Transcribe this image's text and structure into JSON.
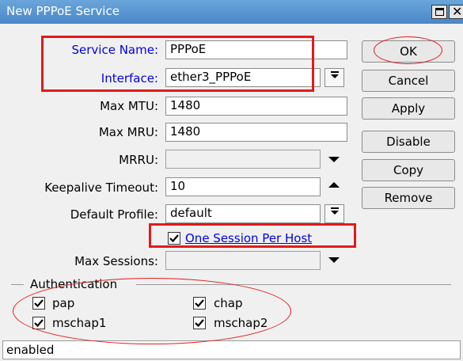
{
  "window": {
    "title": "New PPPoE Service"
  },
  "form": {
    "service_name": {
      "label": "Service Name:",
      "value": "PPPoE"
    },
    "interface": {
      "label": "Interface:",
      "value": "ether3_PPPoE"
    },
    "max_mtu": {
      "label": "Max MTU:",
      "value": "1480"
    },
    "max_mru": {
      "label": "Max MRU:",
      "value": "1480"
    },
    "mrru": {
      "label": "MRRU:",
      "value": ""
    },
    "keepalive_timeout": {
      "label": "Keepalive Timeout:",
      "value": "10"
    },
    "default_profile": {
      "label": "Default Profile:",
      "value": "default"
    },
    "one_session_per_host": {
      "label": "One Session Per Host",
      "checked": true
    },
    "max_sessions": {
      "label": "Max Sessions:",
      "value": ""
    }
  },
  "buttons": {
    "ok": "OK",
    "cancel": "Cancel",
    "apply": "Apply",
    "disable": "Disable",
    "copy": "Copy",
    "remove": "Remove"
  },
  "authentication": {
    "title": "Authentication",
    "options": [
      {
        "label": "pap",
        "checked": true
      },
      {
        "label": "chap",
        "checked": true
      },
      {
        "label": "mschap1",
        "checked": true
      },
      {
        "label": "mschap2",
        "checked": true
      }
    ]
  },
  "status": "enabled",
  "colors": {
    "titlebar": "#5a96d2",
    "label_blue": "#0000e6",
    "highlight_red": "#e21a1a"
  },
  "icons": {
    "dropdown": "triangle-down-icon",
    "spinner": "triangle-up-icon",
    "checkbox": "checkmark-icon"
  }
}
